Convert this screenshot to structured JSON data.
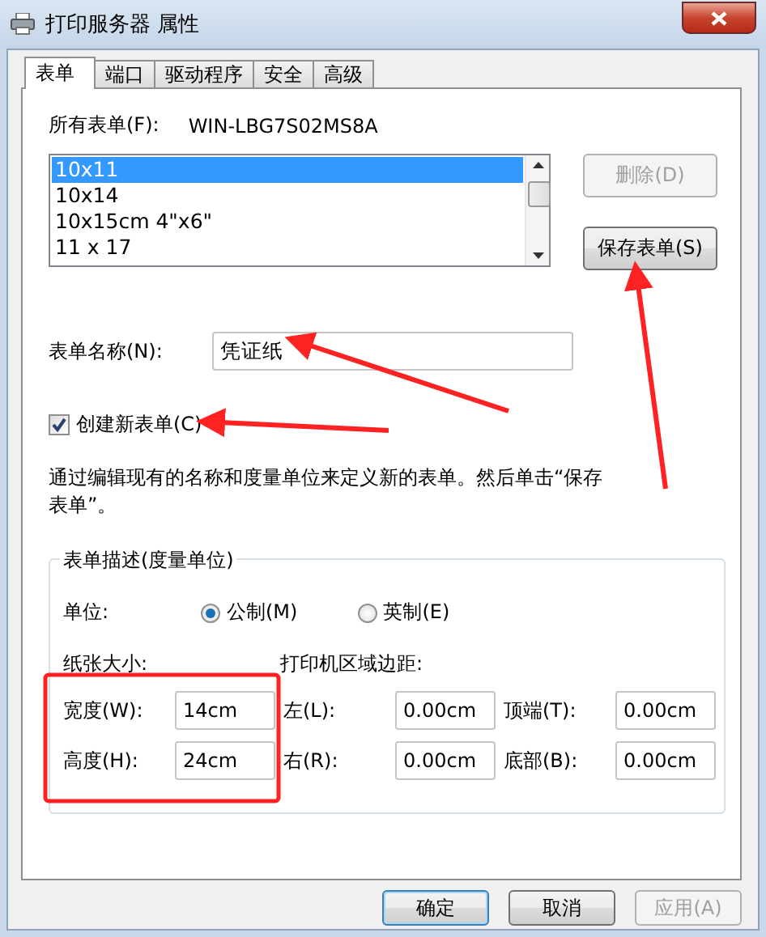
{
  "window": {
    "title": "打印服务器 属性"
  },
  "tabs": [
    {
      "label": "表单",
      "selected": true
    },
    {
      "label": "端口",
      "selected": false
    },
    {
      "label": "驱动程序",
      "selected": false
    },
    {
      "label": "安全",
      "selected": false
    },
    {
      "label": "高级",
      "selected": false
    }
  ],
  "forms_label": "所有表单(F):",
  "server_name": "WIN-LBG7S02MS8A",
  "form_list": [
    {
      "label": "10x11",
      "selected": true
    },
    {
      "label": "10x14",
      "selected": false
    },
    {
      "label": "10x15cm 4\"x6\"",
      "selected": false
    },
    {
      "label": "11 x 17",
      "selected": false
    }
  ],
  "side_buttons": [
    {
      "label": "删除(D)",
      "disabled": true
    },
    {
      "label": "保存表单(S)",
      "disabled": false
    }
  ],
  "form_name": {
    "label": "表单名称(N):",
    "value": "凭证纸"
  },
  "create_new": {
    "label": "创建新表单(C)",
    "checked": true
  },
  "hint": "通过编辑现有的名称和度量单位来定义新的表单。然后单击“保存表单”。",
  "description": {
    "legend": "表单描述(度量单位)",
    "unit_label": "单位:",
    "units": [
      {
        "label": "公制(M)",
        "selected": true
      },
      {
        "label": "英制(E)",
        "selected": false
      }
    ],
    "paper_size": {
      "label": "纸张大小:",
      "fields": [
        {
          "label": "宽度(W):",
          "value": "14cm"
        },
        {
          "label": "高度(H):",
          "value": "24cm"
        }
      ]
    },
    "margins": {
      "label": "打印机区域边距:",
      "fields": [
        {
          "label": "左(L):",
          "value": "0.00cm"
        },
        {
          "label": "顶端(T):",
          "value": "0.00cm"
        },
        {
          "label": "右(R):",
          "value": "0.00cm"
        },
        {
          "label": "底部(B):",
          "value": "0.00cm"
        }
      ]
    }
  },
  "dialog_buttons": [
    {
      "label": "确定",
      "default": true,
      "disabled": false
    },
    {
      "label": "取消",
      "default": false,
      "disabled": false
    },
    {
      "label": "应用(A)",
      "default": false,
      "disabled": true
    }
  ]
}
